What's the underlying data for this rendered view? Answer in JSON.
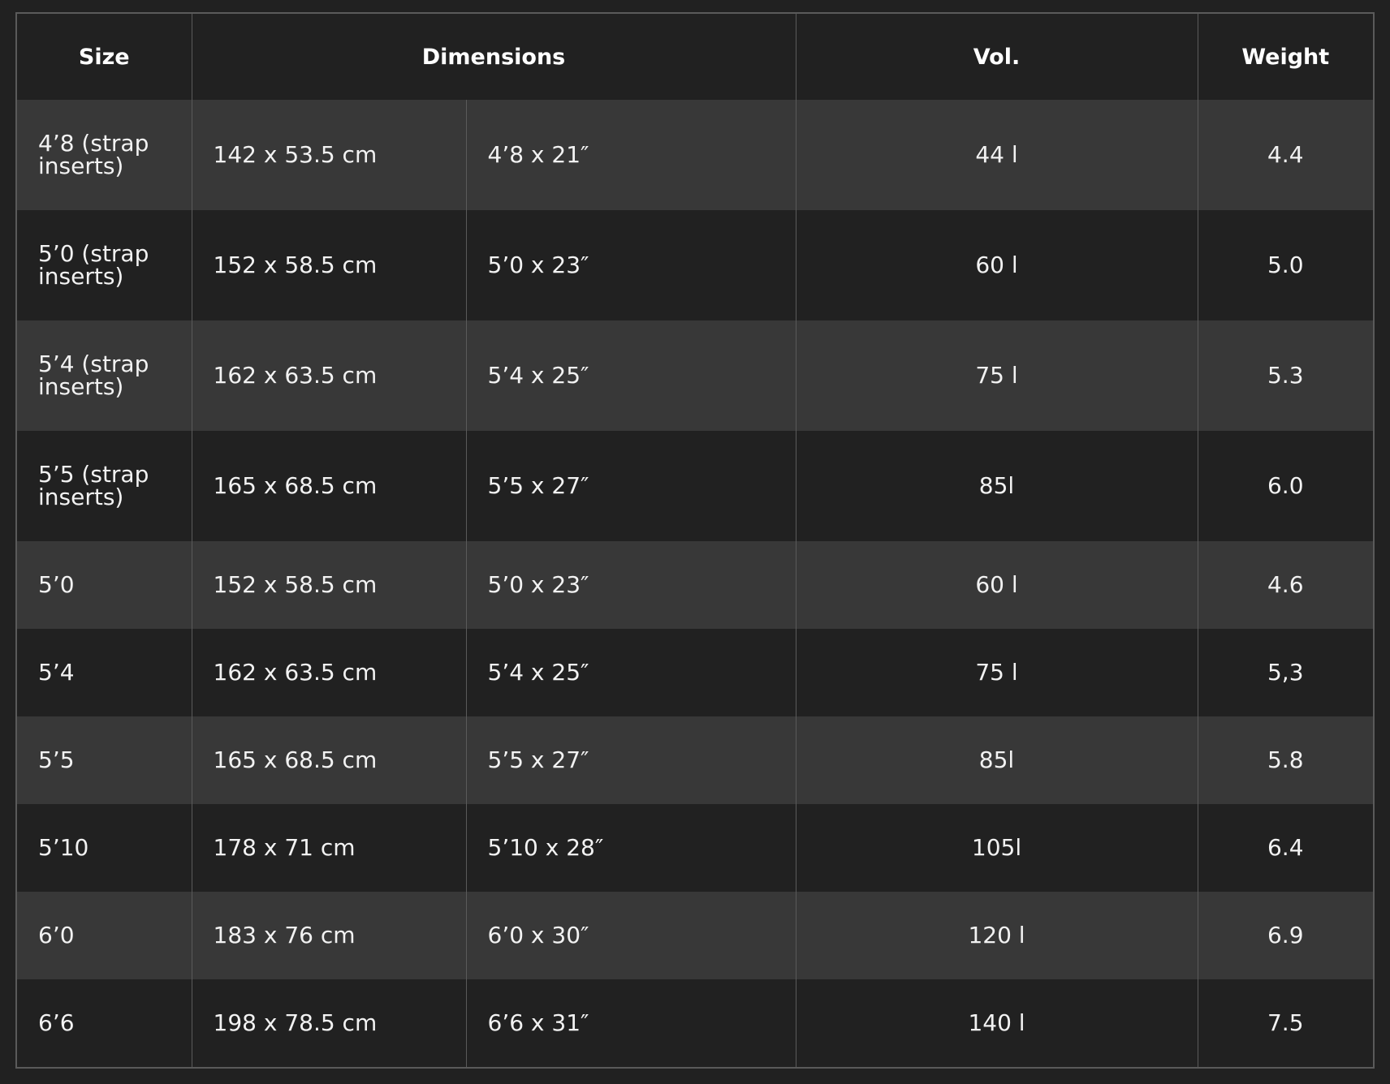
{
  "headers": {
    "size": "Size",
    "dimensions": "Dimensions",
    "volume": "Vol.",
    "weight": "Weight"
  },
  "rows": [
    {
      "size": "4’8 (strap inserts)",
      "cm": "142 x 53.5 cm",
      "inch": "4’8 x 21″",
      "volume": "44 l",
      "weight": "4.4"
    },
    {
      "size": "5’0 (strap inserts)",
      "cm": "152 x 58.5 cm",
      "inch": "5’0 x 23″",
      "volume": "60 l",
      "weight": "5.0"
    },
    {
      "size": "5’4 (strap inserts)",
      "cm": "162 x 63.5 cm",
      "inch": "5’4 x 25″",
      "volume": "75 l",
      "weight": "5.3"
    },
    {
      "size": "5’5 (strap inserts)",
      "cm": "165 x 68.5 cm",
      "inch": "5’5 x 27″",
      "volume": "85l",
      "weight": "6.0"
    },
    {
      "size": "5’0",
      "cm": "152 x 58.5 cm",
      "inch": "5’0 x 23″",
      "volume": "60 l",
      "weight": "4.6"
    },
    {
      "size": "5’4",
      "cm": "162 x 63.5 cm",
      "inch": "5’4 x 25″",
      "volume": "75 l",
      "weight": "5,3"
    },
    {
      "size": "5’5",
      "cm": "165 x 68.5 cm",
      "inch": "5’5 x 27″",
      "volume": "85l",
      "weight": "5.8"
    },
    {
      "size": "5’10",
      "cm": "178 x 71 cm",
      "inch": "5’10 x 28″",
      "volume": "105l",
      "weight": "6.4"
    },
    {
      "size": "6’0",
      "cm": "183 x 76 cm",
      "inch": "6’0 x 30″",
      "volume": "120 l",
      "weight": "6.9"
    },
    {
      "size": "6’6",
      "cm": "198 x 78.5 cm",
      "inch": "6’6 x 31″",
      "volume": "140 l",
      "weight": "7.5"
    }
  ]
}
